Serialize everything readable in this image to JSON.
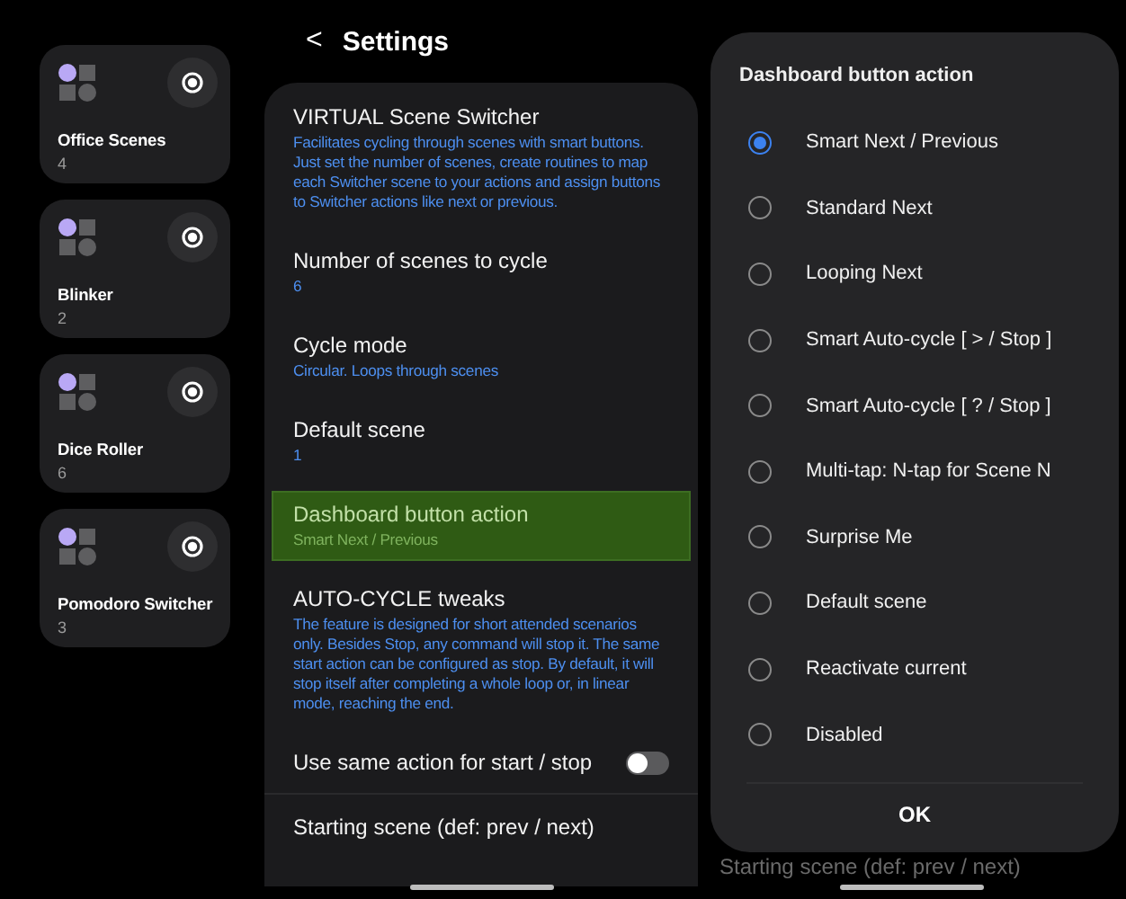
{
  "scene_cards": [
    {
      "name": "Office Scenes",
      "count": "4"
    },
    {
      "name": "Blinker",
      "count": "2"
    },
    {
      "name": "Dice Roller",
      "count": "6"
    },
    {
      "name": "Pomodoro Switcher",
      "count": "3"
    }
  ],
  "settings": {
    "back": "<",
    "title": "Settings",
    "items": [
      {
        "kind": "text",
        "title": "VIRTUAL Scene Switcher",
        "subtitle": "Facilitates cycling through scenes with smart buttons. Just set the number of scenes, create routines to map each Switcher scene to your actions and assign buttons to Switcher actions like next or previous.",
        "selected": false
      },
      {
        "kind": "text",
        "title": "Number of scenes to cycle",
        "subtitle": "6",
        "selected": false
      },
      {
        "kind": "text",
        "title": "Cycle mode",
        "subtitle": "Circular. Loops through scenes",
        "selected": false
      },
      {
        "kind": "text",
        "title": "Default scene",
        "subtitle": "1",
        "selected": false
      },
      {
        "kind": "text",
        "title": "Dashboard button action",
        "subtitle": "Smart Next / Previous",
        "selected": true
      },
      {
        "kind": "text",
        "title": "AUTO-CYCLE tweaks",
        "subtitle": "The feature is designed for short attended scenarios only. Besides Stop, any command will stop it. The same start action can be configured as stop. By default, it will stop itself after completing a whole loop or, in linear mode, reaching the end.",
        "selected": false
      },
      {
        "kind": "toggle",
        "title": "Use same action for start / stop",
        "on": false,
        "selected": false
      },
      {
        "kind": "text",
        "title": "Starting scene (def: prev / next)",
        "selected": false
      }
    ]
  },
  "background_screen": {
    "visible_item": "Starting scene (def: prev / next)"
  },
  "dialog": {
    "title": "Dashboard button action",
    "options": [
      {
        "label": "Smart Next / Previous",
        "selected": true
      },
      {
        "label": "Standard Next",
        "selected": false
      },
      {
        "label": "Looping Next",
        "selected": false
      },
      {
        "label": "Smart Auto-cycle [ > / Stop ]",
        "selected": false
      },
      {
        "label": "Smart Auto-cycle [ ? / Stop ]",
        "selected": false
      },
      {
        "label": "Multi-tap: N-tap for Scene N",
        "selected": false
      },
      {
        "label": "Surprise Me",
        "selected": false
      },
      {
        "label": "Default scene",
        "selected": false
      },
      {
        "label": "Reactivate current",
        "selected": false
      },
      {
        "label": "Disabled",
        "selected": false
      }
    ],
    "button": "OK"
  }
}
